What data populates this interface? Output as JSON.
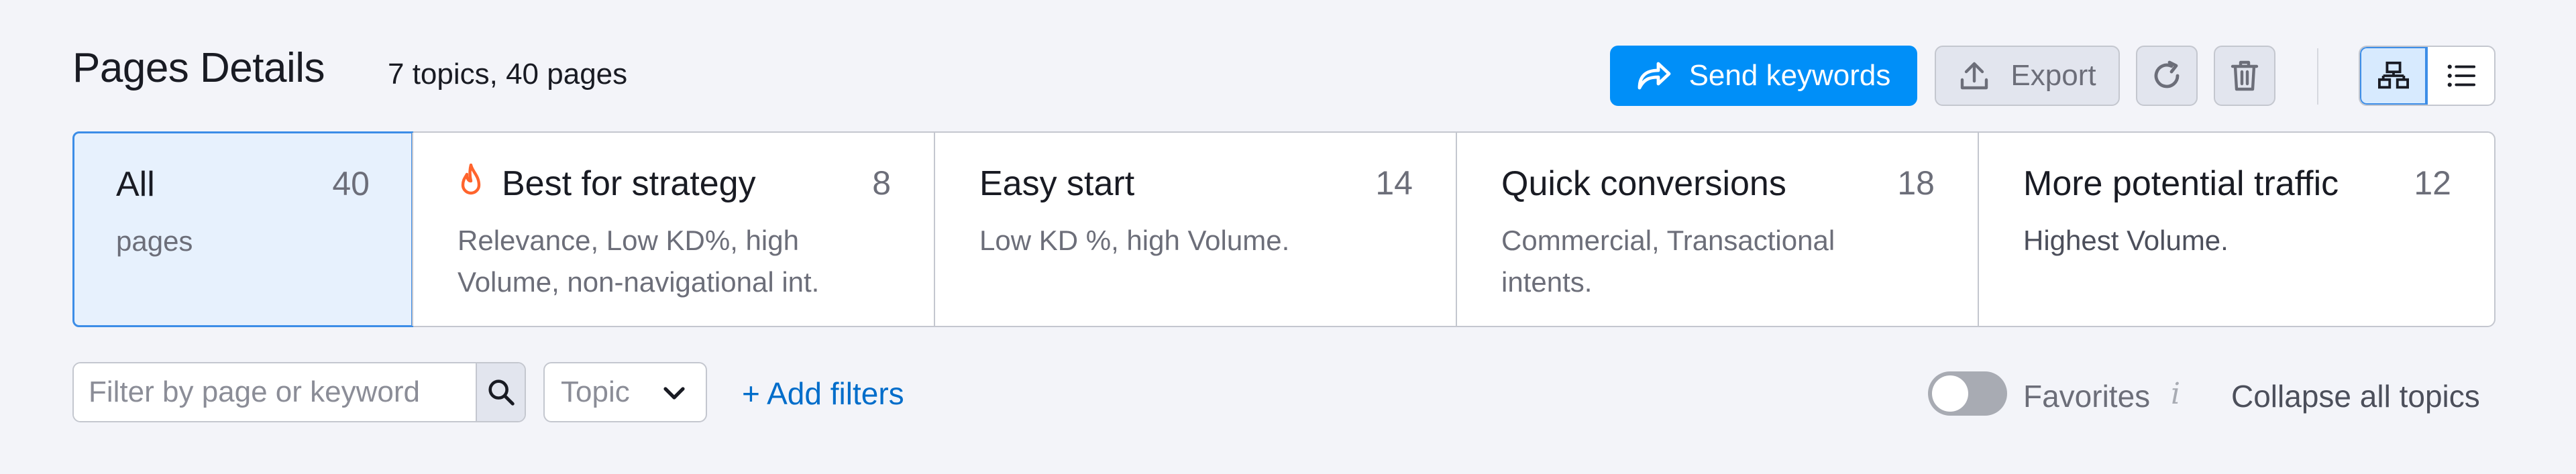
{
  "header": {
    "title": "Pages Details",
    "subtitle": "7 topics, 40 pages",
    "send_keywords_label": "Send keywords",
    "export_label": "Export"
  },
  "icons": {
    "send": "share-arrow-icon",
    "export": "upload-icon",
    "refresh": "refresh-icon",
    "delete": "trash-icon",
    "grid_view": "sitemap-view-icon",
    "list_view": "list-view-icon",
    "search": "search-icon",
    "chevron": "chevron-down-icon",
    "fire": "fire-icon",
    "info": "info-icon"
  },
  "cards": [
    {
      "title": "All",
      "count": "40",
      "desc": "pages",
      "active": true
    },
    {
      "title": "Best for strategy",
      "count": "8",
      "desc_line1": "Relevance, Low KD%, high",
      "desc_line2": "Volume, non-navigational int."
    },
    {
      "title": "Easy start",
      "count": "14",
      "desc_line1": "Low KD %, high Volume."
    },
    {
      "title": "Quick conversions",
      "count": "18",
      "desc_line1": "Commercial, Transactional",
      "desc_line2": "intents."
    },
    {
      "title": "More potential traffic",
      "count": "12",
      "desc_line1": "Highest Volume."
    }
  ],
  "filters": {
    "search_placeholder": "Filter by page or keyword",
    "topic_label": "Topic",
    "add_filters_label": "+ Add filters",
    "favorites_label": "Favorites",
    "favorites_on": false,
    "info_glyph": "i",
    "collapse_label": "Collapse all topics"
  },
  "colors": {
    "primary": "#008ff8",
    "link": "#006dca",
    "active_card_bg": "#e7f1fd",
    "fire": "#ff642d"
  }
}
